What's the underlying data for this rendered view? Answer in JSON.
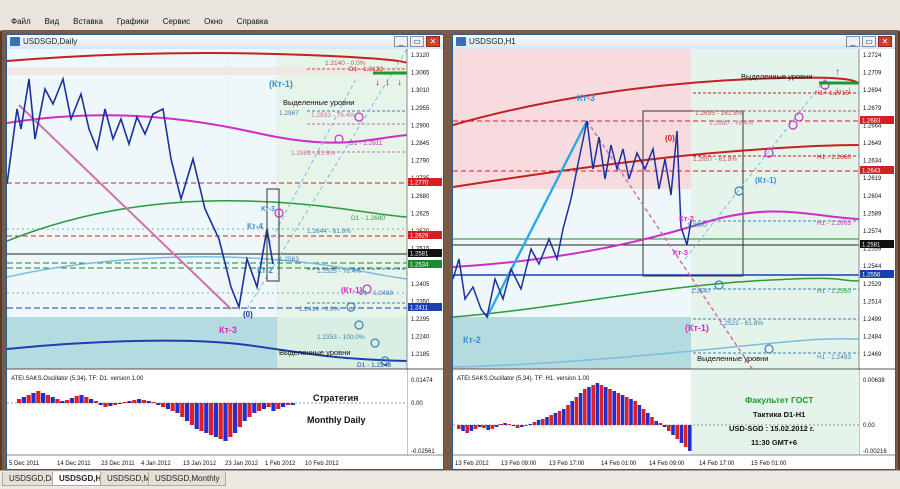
{
  "menu": [
    "Файл",
    "Вид",
    "Вставка",
    "Графики",
    "Сервис",
    "Окно",
    "Справка"
  ],
  "window_buttons": {
    "minimize": "_",
    "restore": "▭",
    "close": "✕"
  },
  "tabs": [
    {
      "label": "USDSGD,Daily",
      "active": false
    },
    {
      "label": "USDSGD,H1",
      "active": true
    },
    {
      "label": "USDSGD,M15",
      "active": false
    },
    {
      "label": "USDSGD,Monthly",
      "active": false
    }
  ],
  "daily": {
    "title": "USDSGD,Daily",
    "price_scale": [
      "1.3120",
      "1.3065",
      "1.3010",
      "1.2955",
      "1.2900",
      "1.2845",
      "1.2790",
      "1.2735",
      "1.2680",
      "1.2625",
      "1.2570",
      "1.2515",
      "1.2460",
      "1.2405",
      "1.2350",
      "1.2295",
      "1.2240",
      "1.2185"
    ],
    "price_tags": [
      {
        "text": "1.2770",
        "color": "#d42020"
      },
      {
        "text": "1.2629",
        "color": "#d42020"
      },
      {
        "text": "1.2581",
        "color": "#111111"
      },
      {
        "text": "1.2534",
        "color": "#1a8a2a"
      },
      {
        "text": "1.2411",
        "color": "#1a3fb0"
      }
    ],
    "level_labels": [
      {
        "text": "1.3140 - 0.0%",
        "color": "#c45050"
      },
      {
        "text": "D1 - 1.3132",
        "color": "#c42020"
      },
      {
        "text": "1.2967",
        "color": "#3a7fb8"
      },
      {
        "text": "1.2933 - 76.4%",
        "color": "#d070a0"
      },
      {
        "text": "D1 - 1.2911",
        "color": "#c030c0"
      },
      {
        "text": "1.2883 - 61.8%",
        "color": "#d070a0"
      },
      {
        "text": "D1 - 1.2690",
        "color": "#2a9a3a"
      },
      {
        "text": "1.2644 - 61.8%",
        "color": "#3a7fb8"
      },
      {
        "text": "1.2563",
        "color": "#3a7fb8"
      },
      {
        "text": "1.2525 - 76.4%",
        "color": "#3a7fb8"
      },
      {
        "text": "D1 - 1.2488",
        "color": "#3a7fb8"
      },
      {
        "text": "1.2414 - 0.0%",
        "color": "#3a7fb8"
      },
      {
        "text": "1.2353 - 100.0%",
        "color": "#3a7fb8"
      },
      {
        "text": "D1 - 1.2248",
        "color": "#1a3fb0"
      }
    ],
    "annotations": {
      "kt1_top": "(Кт-1)",
      "selected_top": "Выделенные уровни",
      "selected_bottom": "Выделенные уровни",
      "kt3": "Кт-3",
      "kt4": "Кт-4",
      "kt3_small": "Кт-3",
      "kt2": "Кт-2",
      "zero": "(0)",
      "kt1_low": "(Кт-1)"
    },
    "oscillator": {
      "label": "ATEI.SAKS.Oscillator (5,34). TF: D1. version 1.00",
      "scale": [
        "0.01474",
        "0.00",
        "-0.02561"
      ],
      "text1": "Стратегия",
      "text2": "Monthly Daily"
    },
    "time_axis": [
      "5 Dec 2011",
      "14 Dec 2011",
      "23 Dec 2011",
      "4 Jan 2012",
      "13 Jan 2012",
      "23 Jan 2012",
      "1 Feb 2012",
      "10 Feb 2012"
    ]
  },
  "h1": {
    "title": "USDSGD,H1",
    "price_scale": [
      "1.2724",
      "1.2709",
      "1.2694",
      "1.2679",
      "1.2664",
      "1.2649",
      "1.2634",
      "1.2619",
      "1.2604",
      "1.2589",
      "1.2574",
      "1.2559",
      "1.2544",
      "1.2529",
      "1.2514",
      "1.2499",
      "1.2484",
      "1.2469"
    ],
    "price_tags": [
      {
        "text": "1.2683",
        "color": "#d42020"
      },
      {
        "text": "1.2643",
        "color": "#d42020"
      },
      {
        "text": "1.2581",
        "color": "#111111"
      },
      {
        "text": "1.2556",
        "color": "#1a3fb0"
      }
    ],
    "level_labels": [
      {
        "text": "H1 - 1.2715",
        "color": "#c42020"
      },
      {
        "text": "1.2695 - 161.8%",
        "color": "#c45050"
      },
      {
        "text": "1.2680 - 76.4%",
        "color": "#d070a0"
      },
      {
        "text": "1.2657 - 61.8%",
        "color": "#c45050"
      },
      {
        "text": "H1 - 1.2660",
        "color": "#c42020"
      },
      {
        "text": "H1 - 1.2605",
        "color": "#c030c0"
      },
      {
        "text": "1.2600",
        "color": "#3a7fb8"
      },
      {
        "text": "H1 - 1.2550",
        "color": "#2a9a3a"
      },
      {
        "text": "1.2547",
        "color": "#3a7fb8"
      },
      {
        "text": "1.2522 - 61.8%",
        "color": "#3a7fb8"
      },
      {
        "text": "H1 - 1.2493",
        "color": "#3a7fb8"
      }
    ],
    "annotations": {
      "kt3": "Кт-3",
      "selected_top": "Выделенные уровни",
      "selected_bottom": "Выделенные уровни",
      "zero": "(0)",
      "kt1": "(Кт-1)",
      "kt2_small": "Кт-2",
      "kt3_small": "Кт-3",
      "kt1_low": "(Кт-1)",
      "kt2": "Кт-2"
    },
    "oscillator": {
      "label": "ATEI.SAKS.Oscillator (5,34). TF: H1. version 1.00",
      "scale": [
        "0.00638",
        "0.00",
        "-0.00216"
      ],
      "line1": "Факультет ГОСТ",
      "line2": "Тактика D1-H1",
      "line3": "USD-SGD : 15.02.2012 г.",
      "line4": "11:30 GMT+6"
    },
    "time_axis": [
      "13 Feb 2012",
      "13 Feb 09:00",
      "13 Feb 17:00",
      "14 Feb 01:00",
      "14 Feb 09:00",
      "14 Feb 17:00",
      "15 Feb 01:00"
    ]
  }
}
